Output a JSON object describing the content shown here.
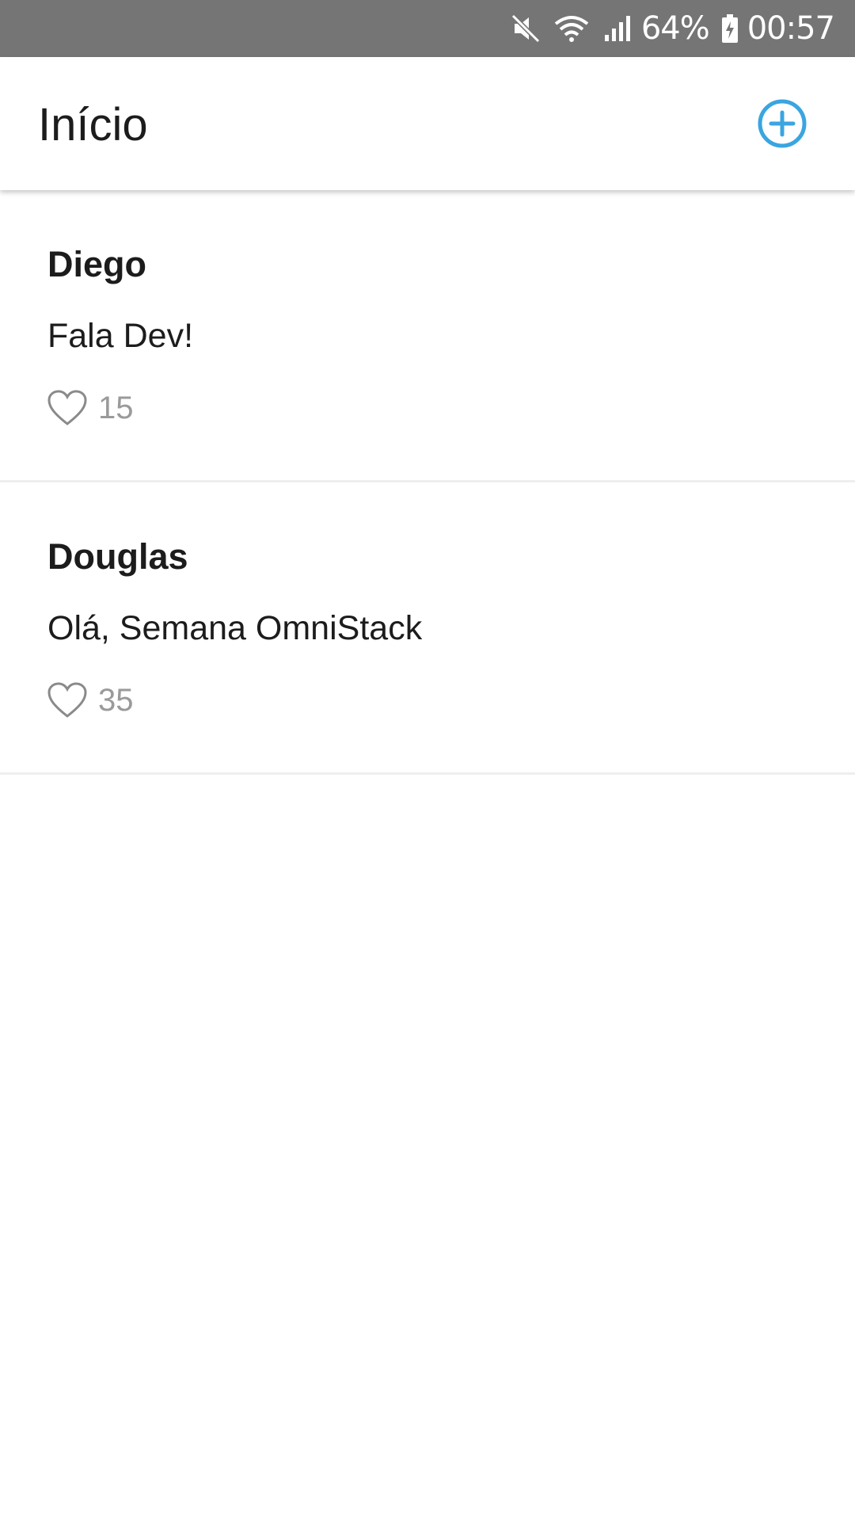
{
  "status_bar": {
    "battery_percent": "64%",
    "time": "00:57",
    "icons": [
      "mute-icon",
      "wifi-icon",
      "signal-icon",
      "battery-charging-icon"
    ]
  },
  "header": {
    "title": "Início",
    "add_button_icon": "plus-circle-icon",
    "accent_color": "#3aa5e0"
  },
  "posts": [
    {
      "author": "Diego",
      "content": "Fala Dev!",
      "likes": "15"
    },
    {
      "author": "Douglas",
      "content": "Olá, Semana OmniStack",
      "likes": "35"
    }
  ],
  "colors": {
    "status_bar_bg": "#757575",
    "text": "#1c1c1c",
    "muted": "#9a9a9a",
    "divider": "#eeeeee"
  }
}
